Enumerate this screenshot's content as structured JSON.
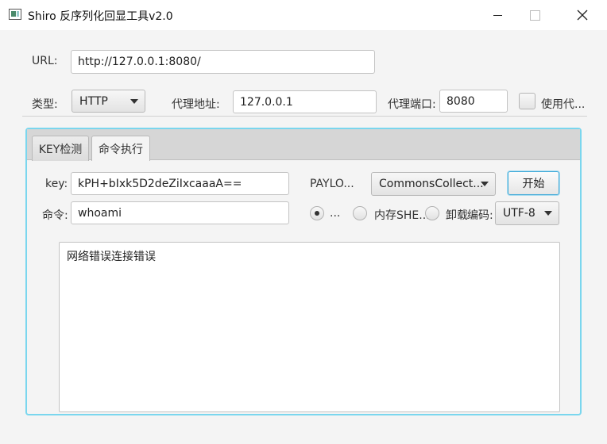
{
  "window": {
    "title": "Shiro 反序列化回显工具v2.0"
  },
  "config": {
    "url_label": "URL:",
    "url_value": "http://127.0.0.1:8080/",
    "type_label": "类型:",
    "type_value": "HTTP",
    "proxy_addr_label": "代理地址:",
    "proxy_addr_value": "127.0.0.1",
    "proxy_port_label": "代理端口:",
    "proxy_port_value": "8080",
    "use_proxy_label": "使用代..."
  },
  "tabs": [
    {
      "label": "KEY检测",
      "active": false
    },
    {
      "label": "命令执行",
      "active": true
    }
  ],
  "command_tab": {
    "key_label": "key:",
    "key_value": "kPH+bIxk5D2deZiIxcaaaA==",
    "command_label": "命令:",
    "command_value": "whoami",
    "payload_label": "PAYLO...",
    "payload_value": "CommonsCollect...",
    "start_button": "开始",
    "radio_option_1": "...",
    "radio_option_2": "内存SHE...",
    "radio_option_3": "卸载",
    "encoding_label": "编码:",
    "encoding_value": "UTF-8",
    "output_text": "网络错误连接错误"
  }
}
